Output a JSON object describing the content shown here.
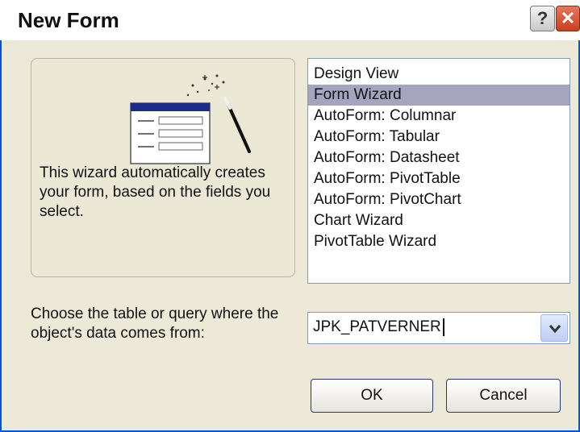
{
  "window": {
    "title": "New Form",
    "help_glyph": "?",
    "close_glyph": "✕"
  },
  "preview": {
    "description": "This wizard automatically creates your form, based on the fields you select."
  },
  "view_list": {
    "items": [
      "Design View",
      "Form Wizard",
      "AutoForm:  Columnar",
      "AutoForm:  Tabular",
      "AutoForm:  Datasheet",
      "AutoForm:  PivotTable",
      "AutoForm:  PivotChart",
      "Chart Wizard",
      "PivotTable Wizard"
    ],
    "selected": "Form Wizard"
  },
  "source": {
    "label": "Choose the table or query where the object's data comes from:",
    "value": "JPK_PATVERNER"
  },
  "buttons": {
    "ok": "OK",
    "cancel": "Cancel"
  },
  "colors": {
    "selection": "#a6a5c0",
    "dialog_bg": "#ece9d8",
    "frame_border": "#0054e3"
  }
}
